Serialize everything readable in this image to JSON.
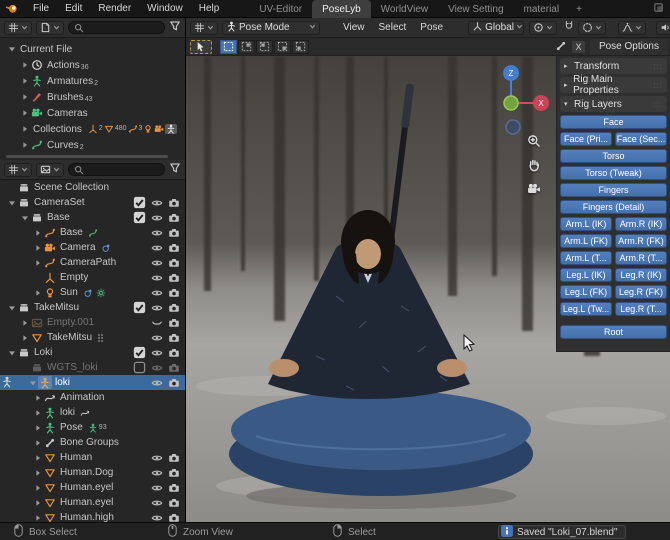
{
  "topbar": {
    "menus": [
      "File",
      "Edit",
      "Render",
      "Window",
      "Help"
    ],
    "tabs": [
      {
        "label": "UV-Editor",
        "active": false
      },
      {
        "label": "PoseLyb",
        "active": true
      },
      {
        "label": "WorldView",
        "active": false
      },
      {
        "label": "View Setting",
        "active": false
      },
      {
        "label": "material",
        "active": false
      }
    ],
    "new_tab_label": "+"
  },
  "viewport": {
    "header": {
      "mode_label": "Pose Mode",
      "menus": [
        "View",
        "Select",
        "Pose"
      ],
      "orientation_label": "Global"
    },
    "gizmo": {
      "axis_top": "Z",
      "axis_right": "X"
    }
  },
  "sidebar": {
    "tab_label": "Pose Options",
    "close_label": "X",
    "panels": [
      {
        "label": "Transform",
        "collapsed": true
      },
      {
        "label": "Rig Main Properties",
        "collapsed": true
      },
      {
        "label": "Rig Layers",
        "collapsed": false
      }
    ],
    "rig_rows": [
      [
        "Face"
      ],
      [
        "Face (Pri...",
        "Face (Sec..."
      ],
      [
        "Torso"
      ],
      [
        "Torso (Tweak)"
      ],
      [
        "Fingers"
      ],
      [
        "Fingers (Detail)"
      ],
      [
        "Arm.L (IK)",
        "Arm.R (IK)"
      ],
      [
        "Arm.L (FK)",
        "Arm.R (FK)"
      ],
      [
        "Arm.L (T...",
        "Arm.R (T..."
      ],
      [
        "Leg.L (IK)",
        "Leg.R (IK)"
      ],
      [
        "Leg.L (FK)",
        "Leg.R (FK)"
      ],
      [
        "Leg.L (Tw...",
        "Leg.R (T..."
      ]
    ],
    "root_label": "Root"
  },
  "blendfile_outliner": {
    "rows": [
      {
        "label": "Current File",
        "arrow": "down",
        "indent": 0
      },
      {
        "label": "Actions",
        "arrow": "right",
        "indent": 1,
        "icon": "action",
        "icon_color": "#d8d8d8",
        "count": "36"
      },
      {
        "label": "Armatures",
        "arrow": "right",
        "indent": 1,
        "icon": "figure",
        "icon_color": "#4fbf7f",
        "count": "2"
      },
      {
        "label": "Brushes",
        "arrow": "right",
        "indent": 1,
        "icon": "brush",
        "icon_color": "#d06060",
        "count": "43"
      },
      {
        "label": "Cameras",
        "arrow": "right",
        "indent": 1,
        "icon": "camera",
        "icon_color": "#4fbf7f",
        "count": ""
      },
      {
        "label": "Collections",
        "arrow": "right",
        "indent": 1,
        "cluster": [
          {
            "icon": "empty",
            "color": "#e8913f",
            "count": "2"
          },
          {
            "icon": "mesh",
            "color": "#e8913f",
            "count": "480"
          },
          {
            "icon": "curve",
            "color": "#e8913f",
            "count": "3"
          },
          {
            "icon": "light",
            "color": "#e8913f",
            "count": ""
          },
          {
            "icon": "camera",
            "color": "#e8913f",
            "count": ""
          },
          {
            "icon": "figure",
            "color": "#e8e8e8",
            "count": "",
            "boxed": true
          }
        ]
      },
      {
        "label": "Curves",
        "arrow": "right",
        "indent": 1,
        "icon": "curve",
        "icon_color": "#4fbf7f",
        "count": "2"
      }
    ]
  },
  "scene_outliner": {
    "rows": [
      {
        "indent": 0,
        "arrow": "none",
        "icon": "collection",
        "icon_color": "#c9c9c9",
        "label": "Scene Collection",
        "toggles": []
      },
      {
        "indent": 0,
        "arrow": "down",
        "icon": "collection",
        "icon_color": "#c9c9c9",
        "label": "CameraSet",
        "toggles": [
          "check",
          "eye",
          "cam"
        ]
      },
      {
        "indent": 1,
        "arrow": "down",
        "icon": "collection",
        "icon_color": "#c9c9c9",
        "label": "Base",
        "toggles": [
          "check",
          "eye",
          "cam"
        ]
      },
      {
        "indent": 2,
        "arrow": "right",
        "icon": "curve",
        "icon_color": "#e8913f",
        "label": "Base",
        "extras": [
          {
            "icon": "curve",
            "color": "#4fbf7f"
          }
        ],
        "toggles": [
          "eye",
          "cam"
        ]
      },
      {
        "indent": 2,
        "arrow": "right",
        "icon": "camera",
        "icon_color": "#e8913f",
        "label": "Camera",
        "extras": [
          {
            "icon": "constraint",
            "color": "#5f8fd3"
          }
        ],
        "toggles": [
          "eye",
          "cam"
        ]
      },
      {
        "indent": 2,
        "arrow": "right",
        "icon": "curve",
        "icon_color": "#e8913f",
        "label": "CameraPath",
        "toggles": [
          "eye",
          "cam"
        ]
      },
      {
        "indent": 2,
        "arrow": "none",
        "icon": "empty",
        "icon_color": "#e8913f",
        "label": "Empty",
        "toggles": [
          "eye",
          "cam"
        ]
      },
      {
        "indent": 2,
        "arrow": "right",
        "icon": "light",
        "icon_color": "#e8913f",
        "label": "Sun",
        "extras": [
          {
            "icon": "constraint",
            "color": "#5f8fd3"
          },
          {
            "icon": "sun",
            "color": "#4fbf7f"
          }
        ],
        "toggles": [
          "eye",
          "cam"
        ]
      },
      {
        "indent": 0,
        "arrow": "down",
        "icon": "collection",
        "icon_color": "#c9c9c9",
        "label": "TakeMitsu",
        "toggles": [
          "check",
          "eye",
          "cam"
        ]
      },
      {
        "indent": 1,
        "arrow": "right",
        "icon": "image",
        "icon_color": "#9a7550",
        "label": "Empty.001",
        "dim": true,
        "toggles": [
          "eyec",
          "cam"
        ]
      },
      {
        "indent": 1,
        "arrow": "right",
        "icon": "mesh",
        "icon_color": "#e8913f",
        "label": "TakeMitsu",
        "extras": [
          {
            "icon": "modifier",
            "color": "#9a9a9a"
          }
        ],
        "toggles": [
          "eye",
          "cam"
        ]
      },
      {
        "indent": 0,
        "arrow": "down",
        "icon": "collection",
        "icon_color": "#c9c9c9",
        "label": "Loki",
        "toggles": [
          "check",
          "eye",
          "cam"
        ]
      },
      {
        "indent": 1,
        "arrow": "none",
        "icon": "collection",
        "icon_color": "#8a8a8a",
        "label": "WGTS_loki",
        "dim": true,
        "toggles": [
          "uncheck",
          "eye-dim",
          "cam-dim"
        ]
      },
      {
        "indent": 1,
        "arrow": "down",
        "icon": "figure",
        "icon_color": "#f0a24a",
        "label": "loki",
        "selected": true,
        "active_icon": true,
        "margin_icon": "figure",
        "toggles": [
          "eye",
          "cam"
        ]
      },
      {
        "indent": 2,
        "arrow": "right",
        "icon": "anim",
        "icon_color": "#c9c9c9",
        "label": "Animation",
        "toggles": []
      },
      {
        "indent": 2,
        "arrow": "right",
        "icon": "figure",
        "icon_color": "#4fbf7f",
        "label": "loki",
        "extras": [
          {
            "icon": "anim",
            "color": "#c9c9c9"
          }
        ],
        "toggles": []
      },
      {
        "indent": 2,
        "arrow": "right",
        "icon": "figure",
        "icon_color": "#4fbf7f",
        "label": "Pose",
        "extras": [
          {
            "icon": "figure",
            "color": "#4fbf7f",
            "count": "93",
            "boxed": true
          }
        ],
        "toggles": []
      },
      {
        "indent": 2,
        "arrow": "right",
        "icon": "bone",
        "icon_color": "#c9c9c9",
        "label": "Bone Groups",
        "toggles": []
      },
      {
        "indent": 2,
        "arrow": "right",
        "icon": "mesh",
        "icon_color": "#e8913f",
        "label": "Human",
        "toggles": [
          "eye",
          "cam"
        ]
      },
      {
        "indent": 2,
        "arrow": "right",
        "icon": "mesh",
        "icon_color": "#e8913f",
        "label": "Human.Dog",
        "toggles": [
          "eye",
          "cam"
        ]
      },
      {
        "indent": 2,
        "arrow": "right",
        "icon": "mesh",
        "icon_color": "#e8913f",
        "label": "Human.eyel",
        "toggles": [
          "eye",
          "cam"
        ]
      },
      {
        "indent": 2,
        "arrow": "right",
        "icon": "mesh",
        "icon_color": "#e8913f",
        "label": "Human.eyel",
        "toggles": [
          "eye",
          "cam"
        ]
      },
      {
        "indent": 2,
        "arrow": "right",
        "icon": "mesh",
        "icon_color": "#e8913f",
        "label": "Human.high",
        "toggles": [
          "eye",
          "cam"
        ]
      }
    ]
  },
  "statusbar": {
    "hints": [
      {
        "mouse": "lmb",
        "label": "Box Select"
      },
      {
        "mouse": "mmb",
        "label": "Zoom View"
      },
      {
        "mouse": "rmb",
        "label": "Select"
      }
    ],
    "saved_label": "Saved \"Loki_07.blend\""
  },
  "colors": {
    "accent_blue": "#4772b3",
    "selection_blue": "#3c6a9d",
    "object_orange": "#e8913f",
    "data_green": "#4fbf7f"
  }
}
